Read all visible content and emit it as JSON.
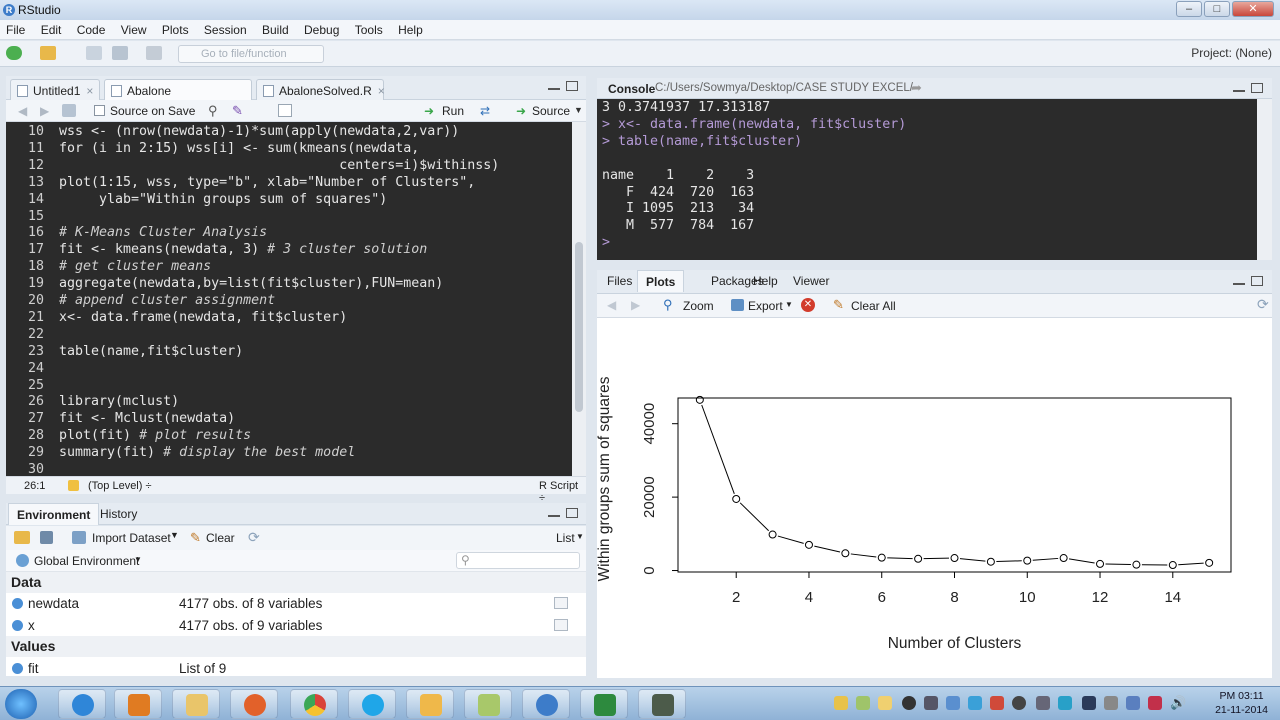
{
  "app": {
    "title": "RStudio",
    "icon": "r-logo-icon"
  },
  "menu": [
    "File",
    "Edit",
    "Code",
    "View",
    "Plots",
    "Session",
    "Build",
    "Debug",
    "Tools",
    "Help"
  ],
  "toolbar": {
    "goto_placeholder": "Go to file/function",
    "project": "Project: (None)"
  },
  "editor": {
    "tabs": [
      {
        "label": "Untitled1",
        "close": "×"
      },
      {
        "label": "Abalone clustering.R",
        "close": "×"
      },
      {
        "label": "AbaloneSolved.R",
        "close": "×"
      }
    ],
    "source_on_save": "Source on Save",
    "run_label": "Run",
    "source_label": "Source",
    "lines": [
      {
        "n": "10",
        "code": "wss <- (nrow(newdata)-1)*sum(apply(newdata,2,var))",
        "type": "code"
      },
      {
        "n": "11",
        "code": "for (i in 2:15) wss[i] <- sum(kmeans(newdata,",
        "type": "code"
      },
      {
        "n": "12",
        "code": "                                   centers=i)$withinss)",
        "type": "code"
      },
      {
        "n": "13",
        "code": "plot(1:15, wss, type=\"b\", xlab=\"Number of Clusters\",",
        "type": "code"
      },
      {
        "n": "14",
        "code": "     ylab=\"Within groups sum of squares\")",
        "type": "code"
      },
      {
        "n": "15",
        "code": "",
        "type": "code"
      },
      {
        "n": "16",
        "code": "# K-Means Cluster Analysis",
        "type": "comment"
      },
      {
        "n": "17",
        "code": "fit <- kmeans(newdata, 3) ",
        "comment": "# 3 cluster solution",
        "type": "mixed"
      },
      {
        "n": "18",
        "code": "# get cluster means",
        "type": "comment"
      },
      {
        "n": "19",
        "code": "aggregate(newdata,by=list(fit$cluster),FUN=mean)",
        "type": "code"
      },
      {
        "n": "20",
        "code": "# append cluster assignment",
        "type": "comment"
      },
      {
        "n": "21",
        "code": "x<- data.frame(newdata, fit$cluster)",
        "type": "code"
      },
      {
        "n": "22",
        "code": "",
        "type": "code"
      },
      {
        "n": "23",
        "code": "table(name,fit$cluster)",
        "type": "code"
      },
      {
        "n": "24",
        "code": "",
        "type": "code"
      },
      {
        "n": "25",
        "code": "",
        "type": "code"
      },
      {
        "n": "26",
        "code": "library(mclust)",
        "type": "code"
      },
      {
        "n": "27",
        "code": "fit <- Mclust(newdata)",
        "type": "code"
      },
      {
        "n": "28",
        "code": "plot(fit) ",
        "comment": "# plot results",
        "type": "mixed"
      },
      {
        "n": "29",
        "code": "summary(fit) ",
        "comment": "# display the best model",
        "type": "mixed"
      },
      {
        "n": "30",
        "code": "",
        "type": "code"
      }
    ],
    "status_pos": "26:1",
    "status_level": "(Top Level) ÷",
    "status_type": "R Script ÷"
  },
  "environment": {
    "tabs": [
      "Environment",
      "History"
    ],
    "import_label": "Import Dataset",
    "clear_label": "Clear",
    "list_label": "List",
    "scope": "Global Environment",
    "sections": [
      {
        "title": "Data",
        "rows": [
          {
            "name": "newdata",
            "value": "4177 obs. of 8 variables"
          },
          {
            "name": "x",
            "value": "4177 obs. of 9 variables"
          }
        ]
      },
      {
        "title": "Values",
        "rows": [
          {
            "name": "fit",
            "value": "List of 9"
          }
        ]
      }
    ]
  },
  "console": {
    "title": "Console",
    "path": "C:/Users/Sowmya/Desktop/CASE STUDY EXCEL/",
    "lines": [
      {
        "text": "3 0.3741937 17.313187",
        "type": "out"
      },
      {
        "text": "> x<- data.frame(newdata, fit$cluster)",
        "type": "cmd"
      },
      {
        "text": "> table(name,fit$cluster)",
        "type": "cmd"
      },
      {
        "text": "",
        "type": "out"
      },
      {
        "text": "name    1    2    3",
        "type": "out"
      },
      {
        "text": "   F  424  720  163",
        "type": "out"
      },
      {
        "text": "   I 1095  213   34",
        "type": "out"
      },
      {
        "text": "   M  577  784  167",
        "type": "out"
      },
      {
        "text": "> ",
        "type": "cmd"
      }
    ]
  },
  "plots_pane": {
    "tabs": [
      "Files",
      "Plots",
      "Packages",
      "Help",
      "Viewer"
    ],
    "active_tab": "Plots",
    "zoom_label": "Zoom",
    "export_label": "Export",
    "clear_all_label": "Clear All"
  },
  "chart_data": {
    "type": "line",
    "x": [
      1,
      2,
      3,
      4,
      5,
      6,
      7,
      8,
      9,
      10,
      11,
      12,
      13,
      14,
      15
    ],
    "y": [
      46500,
      19500,
      9800,
      7000,
      4700,
      3500,
      3200,
      3400,
      2400,
      2700,
      3400,
      1800,
      1600,
      1500,
      2100
    ],
    "xlabel": "Number of Clusters",
    "ylabel": "Within groups sum of squares",
    "xticks": [
      2,
      4,
      6,
      8,
      10,
      12,
      14
    ],
    "yticks": [
      0,
      20000,
      40000
    ],
    "xlim": [
      0.4,
      15.6
    ],
    "ylim": [
      -400,
      47000
    ],
    "marker": "open-circle",
    "grid": false
  },
  "taskbar": {
    "apps": [
      "start-orb-icon",
      "ie-icon",
      "media-player-icon",
      "explorer-icon",
      "firefox-icon",
      "chrome-icon",
      "skype-icon",
      "outlook-icon",
      "notes-icon",
      "rstudio-icon",
      "excel-icon",
      "sticky-icon"
    ],
    "time": "PM 03:11",
    "date": "21-11-2014"
  }
}
